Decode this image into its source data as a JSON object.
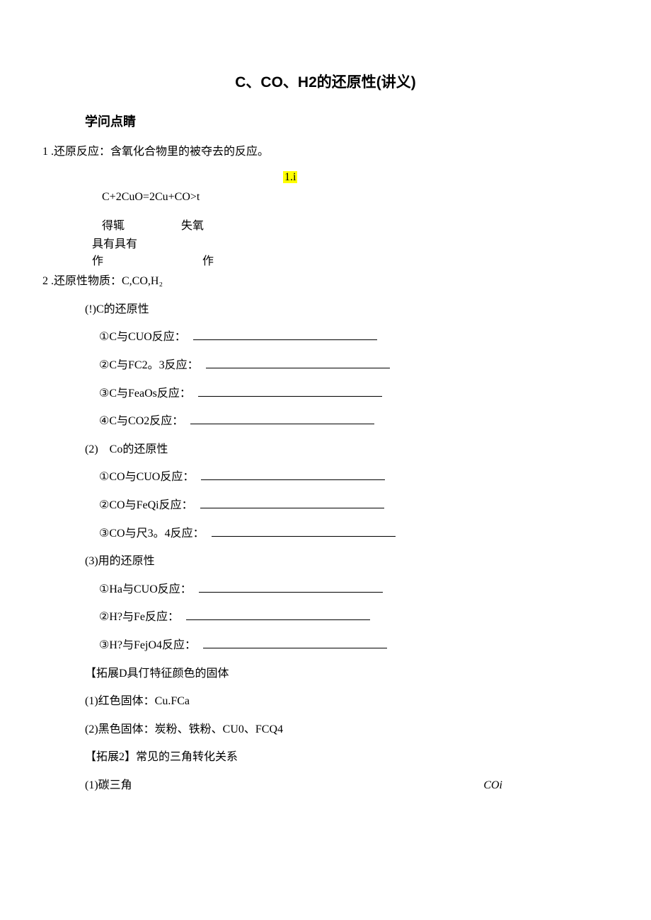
{
  "title": "C、CO、H2的还原性(讲义)",
  "subtitle": "学问点睛",
  "item1": "1 .还原反应：含氧化合物里的被夺去的反应。",
  "hl": "1.i",
  "eq": "C+2CuO=2Cu+CO>t",
  "row2a": "得辄",
  "row2b": "失氧",
  "row3": "具有具有",
  "row4a": "作",
  "row4b": "作",
  "item2": "2 .还原性物质：C,CO,H₂",
  "sec1": "(!)C的还原性",
  "s1_1": "①C与CUO反应：",
  "s1_2": "②C与FC2。3反应：",
  "s1_3": "③C与FeaOs反应：",
  "s1_4": "④C与CO2反应：",
  "sec2_num": "(2)",
  "sec2_txt": "Co的还原性",
  "s2_1": "①CO与CUO反应：",
  "s2_2": "②CO与FeQi反应：",
  "s2_3": "③CO与尺3。4反应：",
  "sec3": "(3)用的还原性",
  "s3_1": "①Ha与CUO反应：",
  "s3_2": "②H?与Fe反应：",
  "s3_3": "③H?与FejO4反应：",
  "ext1": "【拓展D具仃特征颜色的固体",
  "ext1_1": "(1)红色固体：Cu.FCa",
  "ext1_2": "(2)黑色固体：炭粉、铁粉、CU0、FCQ4",
  "ext2": "【拓展2】常见的三角转化关系",
  "ext2_1": "(1)碳三角",
  "coi": "COi"
}
